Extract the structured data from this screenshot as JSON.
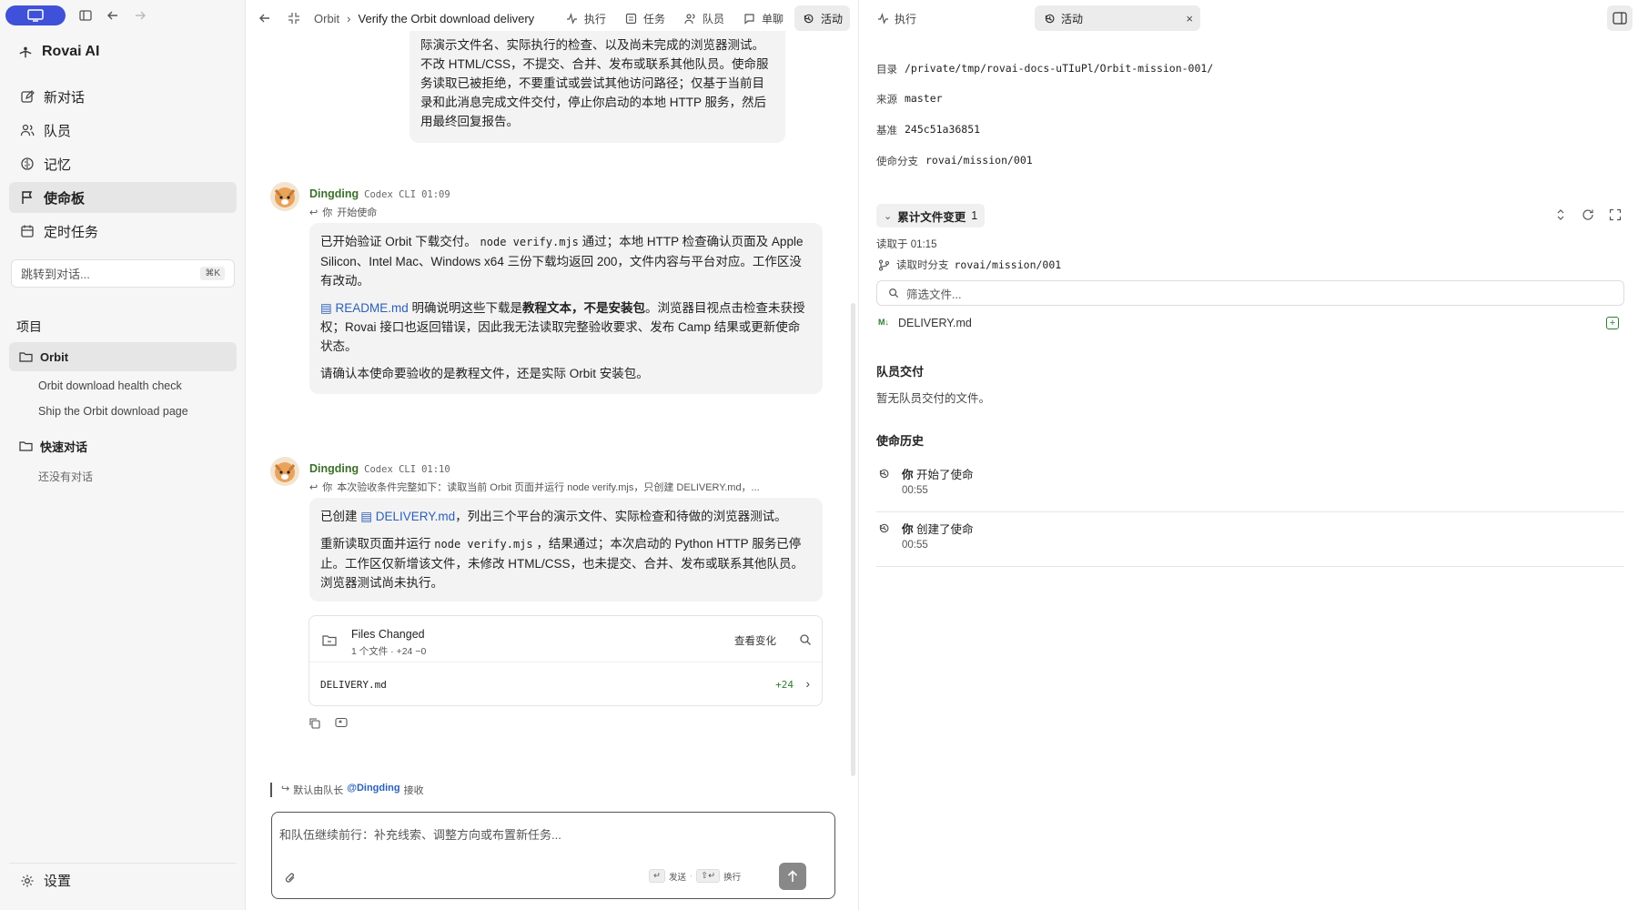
{
  "sidebar": {
    "brand": "Rovai AI",
    "nav": [
      {
        "label": "新对话",
        "icon": "edit-icon"
      },
      {
        "label": "队员",
        "icon": "users-icon"
      },
      {
        "label": "记忆",
        "icon": "brain-icon"
      },
      {
        "label": "使命板",
        "icon": "flag-icon",
        "active": true
      },
      {
        "label": "定时任务",
        "icon": "calendar-icon"
      }
    ],
    "jump_placeholder": "跳转到对话...",
    "jump_shortcut": "⌘K",
    "projects_title": "项目",
    "project": "Orbit",
    "project_items": [
      "Orbit download health check",
      "Ship the Orbit download page"
    ],
    "quick_title": "快速对话",
    "quick_empty": "还没有对话",
    "settings": "设置"
  },
  "center": {
    "breadcrumb_root": "Orbit",
    "breadcrumb_sep": "›",
    "breadcrumb_title": "Verify the Orbit download delivery",
    "tabs": [
      "执行",
      "任务",
      "队员",
      "单聊",
      "活动"
    ],
    "user_bubble_tail": "际演示文件名、实际执行的检查、以及尚未完成的浏览器测试。不改 HTML/CSS，不提交、合并、发布或联系其他队员。使命服务读取已被拒绝，不要重试或尝试其他访问路径；仅基于当前目录和此消息完成文件交付，停止你启动的本地 HTTP 服务，然后用最终回复报告。",
    "msg1": {
      "name": "Dingding",
      "source": "Codex CLI",
      "time": "01:09",
      "reply_user": "你",
      "reply_text": "开始使命",
      "p1_a": "已开始验证 Orbit 下载交付。",
      "p1_code": "node verify.mjs",
      "p1_b": "通过；本地 HTTP 检查确认页面及 Apple Silicon、Intel Mac、Windows x64 三份下载均返回 200，文件内容与平台对应。工作区没有改动。",
      "p2_link": "README.md",
      "p2_a": "明确说明这些下载是",
      "p2_bold": "教程文本，不是安装包",
      "p2_b": "。浏览器目视点击检查未获授权；Rovai 接口也返回错误，因此我无法读取完整验收要求、发布 Camp 结果或更新使命状态。",
      "p3": "请确认本使命要验收的是教程文件，还是实际 Orbit 安装包。"
    },
    "msg2": {
      "name": "Dingding",
      "source": "Codex CLI",
      "time": "01:10",
      "reply_user": "你",
      "reply_text": "本次验收条件完整如下：读取当前 Orbit 页面并运行 node verify.mjs，只创建 DELIVERY.md，...",
      "p1_a": "已创建",
      "p1_link": "DELIVERY.md",
      "p1_b": "，列出三个平台的演示文件、实际检查和待做的浏览器测试。",
      "p2_a": "重新读取页面并运行",
      "p2_code": "node verify.mjs",
      "p2_b": "，结果通过；本次启动的 Python HTTP 服务已停止。工作区仅新增该文件，未修改 HTML/CSS，也未提交、合并、发布或联系其他队员。浏览器测试尚未执行。"
    },
    "files_card": {
      "title": "Files Changed",
      "summary": "1 个文件 · +24 −0",
      "action": "查看变化",
      "file": "DELIVERY.md",
      "added": "+24"
    },
    "assign_prefix": "默认由队长",
    "assign_mention": "@Dingding",
    "assign_suffix": "接收",
    "composer_placeholder": "和队伍继续前行：补充线索、调整方向或布置新任务...",
    "send_key": "↵",
    "send_label": "发送",
    "newline_key": "⇧↵",
    "newline_label": "换行"
  },
  "right": {
    "tab_exec": "执行",
    "tab_activity": "活动",
    "dir_label": "目录",
    "dir_value": "/private/tmp/rovai-docs-uTIuPl/Orbit-mission-001/",
    "source_label": "来源",
    "source_value": "master",
    "base_label": "基准",
    "base_value": "245c51a36851",
    "branch_label": "使命分支",
    "branch_value": "rovai/mission/001",
    "cum_title": "累计文件变更",
    "cum_count": "1",
    "read_at": "读取于 01:15",
    "read_branch_label": "读取时分支",
    "read_branch_value": "rovai/mission/001",
    "filter_placeholder": "筛选文件...",
    "file": "DELIVERY.md",
    "deliver_title": "队员交付",
    "deliver_empty": "暂无队员交付的文件。",
    "history_title": "使命历史",
    "history": [
      {
        "who": "你",
        "what": "开始了使命",
        "time": "00:55"
      },
      {
        "who": "你",
        "what": "创建了使命",
        "time": "00:55"
      }
    ]
  },
  "colors": {
    "accent": "#3f51d8",
    "link": "#2b5fb8",
    "name_green": "#3c6f2b",
    "added_green": "#2e7d32"
  }
}
